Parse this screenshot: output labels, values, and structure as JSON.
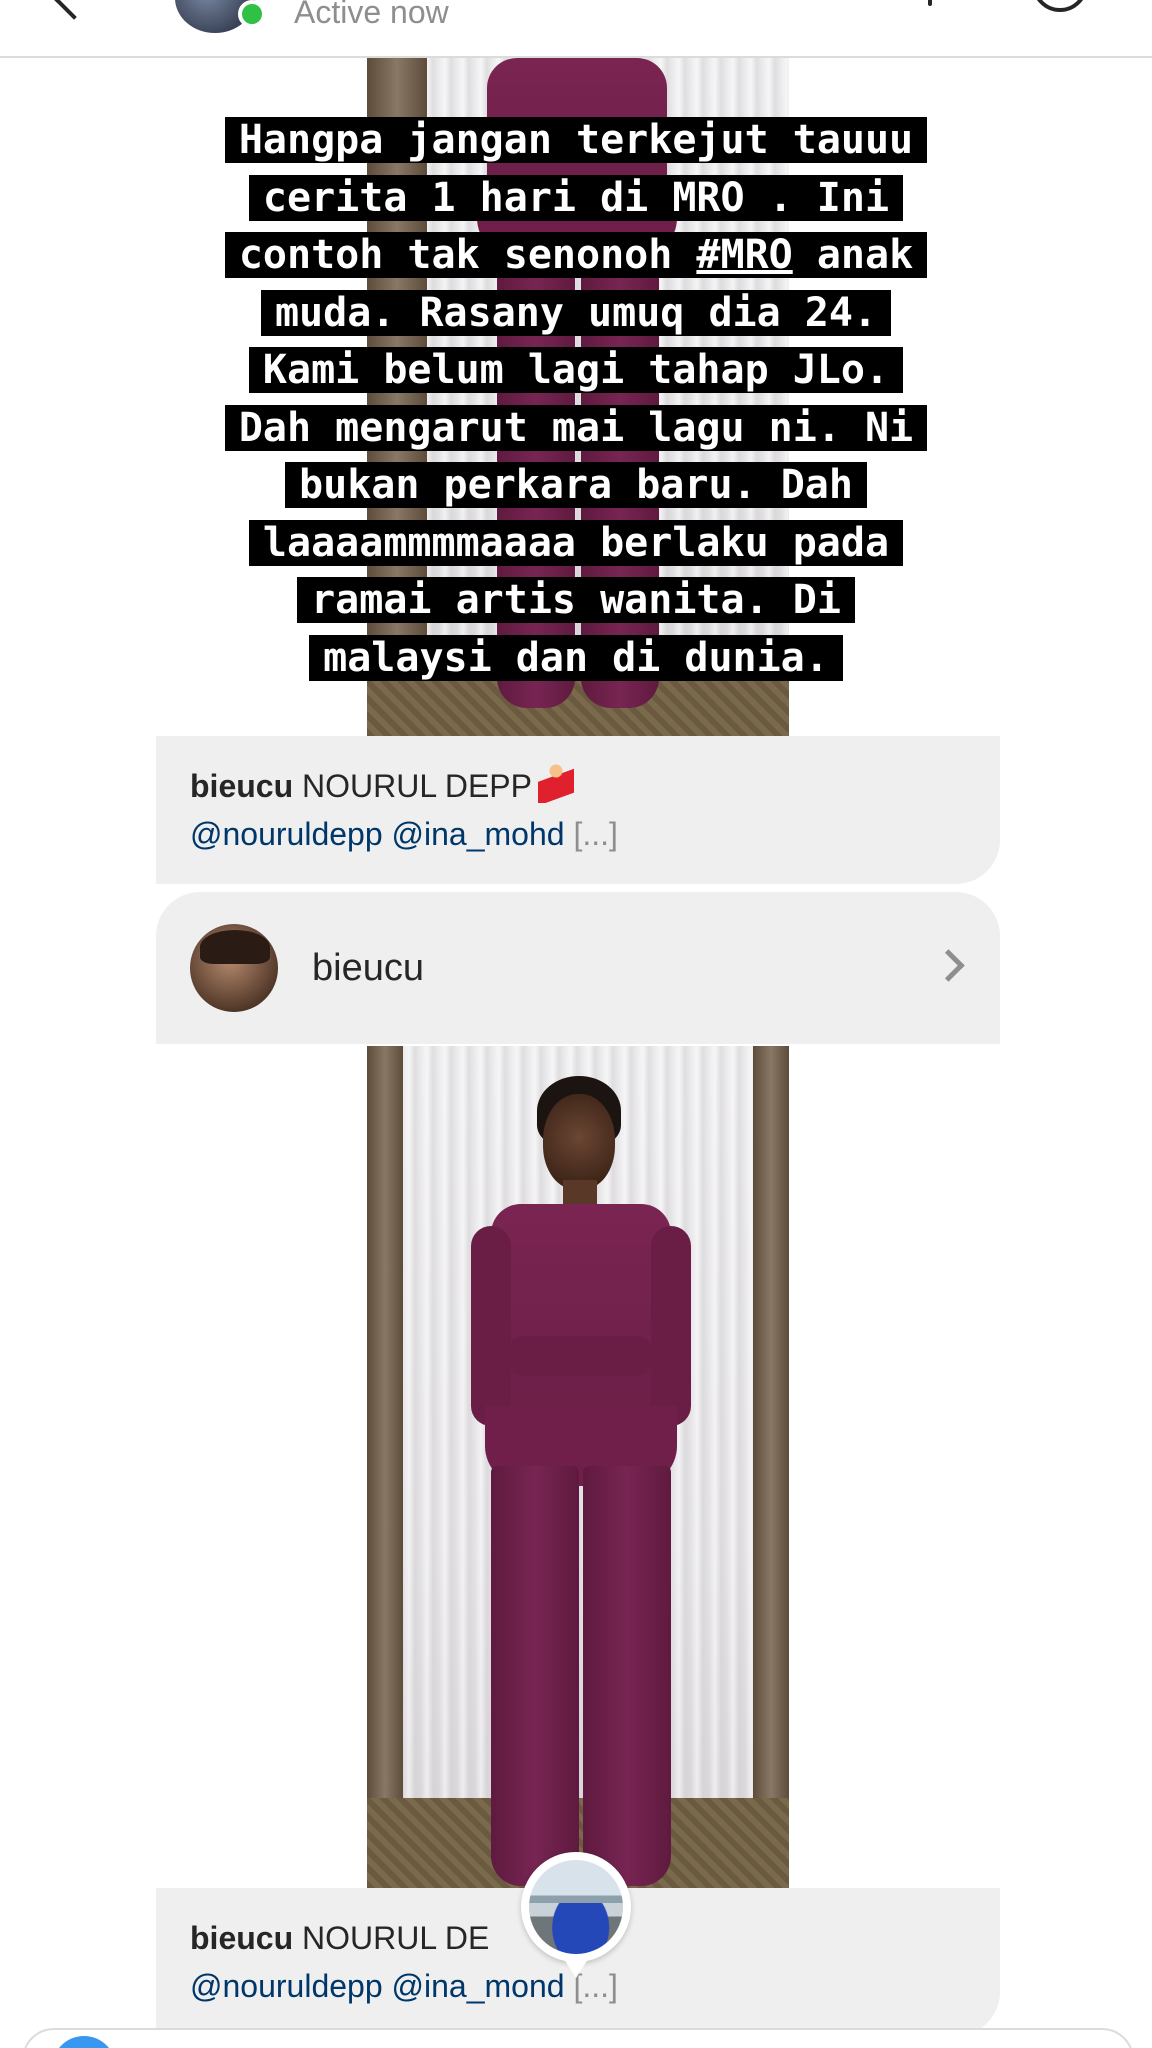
{
  "header": {
    "status": "Active now"
  },
  "story": {
    "caption_lines": [
      "Hangpa jangan terkejut tauuu",
      "cerita 1 hari di MRO .  Ini",
      "contoh tak senonoh ",
      "#MRO",
      " anak",
      "muda. Rasany umuq dia 24.",
      "Kami belum lagi tahap JLo.",
      "Dah mengarut mai lagu ni. Ni",
      "bukan perkara baru. Dah",
      "laaaammmmaaaa berlaku pada",
      "ramai artis wanita. Di",
      "malaysi dan di dunia."
    ]
  },
  "messages": [
    {
      "username": "bieucu",
      "caption": "NOURUL DEPP",
      "emoji": "dancer-emoji",
      "mentions": "@nouruldepp @ina_mohd",
      "more": "[...]"
    },
    {
      "username": "bieucu",
      "caption": "NOURUL DE",
      "mentions": "@nouruldepp @ina_mond",
      "more": "[...]"
    }
  ],
  "profile_card": {
    "name": "bieucu"
  },
  "colors": {
    "mention": "#00376b",
    "card_bg": "#efefef",
    "online": "#31c046",
    "outfit": "#6c1f48"
  }
}
